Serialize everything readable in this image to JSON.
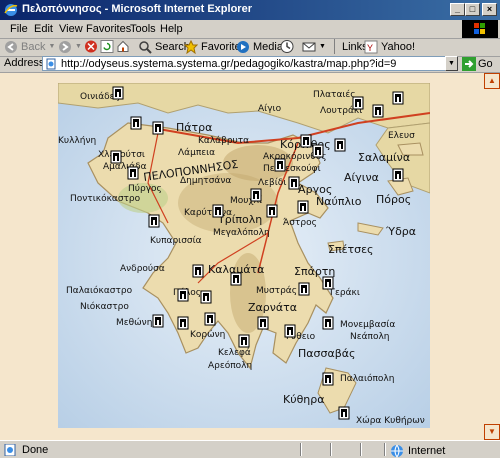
{
  "window": {
    "title": "Πελοπόννησος - Microsoft Internet Explorer",
    "min": "_",
    "max": "□",
    "close": "×"
  },
  "menu": [
    "File",
    "Edit",
    "View",
    "Favorites",
    "Tools",
    "Help"
  ],
  "toolbar": {
    "back": "Back",
    "search": "Search",
    "favorites": "Favorites",
    "media": "Media",
    "links": "Links",
    "yahoo": "Yahoo!"
  },
  "address": {
    "label": "Address",
    "url": "http://odyseus.systema.systema.gr/pedagogiko/kastra/map.php?id=9",
    "go": "Go"
  },
  "map": {
    "labels": {
      "patra": "Πάτρα",
      "korinthos": "Κόρινθος",
      "kalamata": "Καλαμάτα",
      "sparti": "Σπάρτη",
      "tripoli": "Τρίπολη",
      "argos": "Άργος",
      "nafplio": "Ναύπλιο",
      "kythira": "Κύθηρα",
      "pylos": "Πύλος",
      "methoni": "Μεθώνη",
      "koroni": "Κορώνη",
      "monemvasia": "Μονεμβασία",
      "gytheio": "Γύθειο",
      "pyrgos": "Πύργος",
      "amaliada": "Αμαλιάδα",
      "killini": "Κυλλήνη",
      "chlemoutsi": "Χλεμούτσι",
      "pontikokastro": "Ποντικόκαστρο",
      "kyparissia": "Κυπαρισσία",
      "karytaina": "Καρύταινα",
      "megalopoli": "Μεγαλόπολη",
      "kalavryta": "Καλάβρυτα",
      "akrokorinthos": "Ακροκόρινθος",
      "peloponnisos": "ΠΕΛΟΠΟΝΝΗΣΟΣ",
      "salamina": "Σαλαμίνα",
      "aigina": "Αίγινα",
      "poros": "Πόρος",
      "ydra": "Ύδρα",
      "spetses": "Σπέτσες",
      "elefsina": "Ελευσ",
      "androusa": "Ανδρούσα",
      "palaiokastro": "Παλαιόκαστρο",
      "niokastro": "Νιόκαστρο",
      "mystras": "Μυστράς",
      "zarnata": "Ζαρνάτα",
      "geraki": "Γεράκι",
      "kelefa": "Κελεφά",
      "areopoli": "Αρεόπολη",
      "passavas": "Πασσαβάς",
      "neapoli": "Νεάπολη",
      "palaiopoli": "Παλαιόπολη",
      "chora_kythiron": "Χώρα Κυθήρων",
      "astros": "Άστρος",
      "mouchli": "Μουχλί",
      "lamia": "Λάμπεια",
      "dimitsana": "Δημητσάνα",
      "levidi": "Λεβίδι",
      "platies": "Πλαταιές",
      "oinies": "Οινιάδες",
      "aigio": "Αίγιο",
      "loutraki": "Λουτράκι",
      "pentekouphi": "Πεντεσκούφι"
    }
  },
  "status": {
    "text": "Done",
    "zone": "Internet"
  }
}
